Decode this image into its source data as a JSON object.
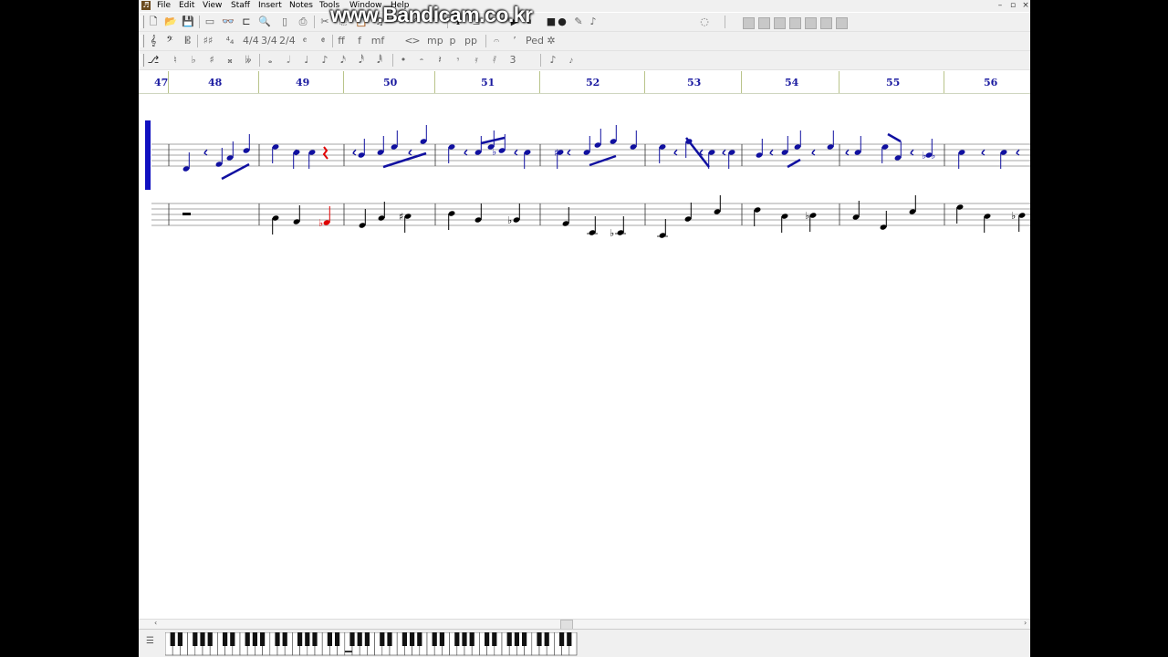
{
  "app": {
    "window_controls": [
      "–",
      "▫",
      "×"
    ]
  },
  "menu": [
    "File",
    "Edit",
    "View",
    "Staff",
    "Insert",
    "Notes",
    "Tools",
    "Window",
    "Help"
  ],
  "watermark": "www.Bandicam.co.kr",
  "toolbar1": {
    "icons": [
      "new-file-icon",
      "open-file-icon",
      "save-icon",
      "print-preview-icon",
      "view-icon",
      "staff-add-icon",
      "zoom-icon",
      "page-icon",
      "print-icon",
      "cut-icon",
      "copy-icon",
      "paste-icon",
      "notes-icon",
      "dash-icon",
      "undo-icon",
      "redo-icon",
      "info-icon",
      "separator-icon",
      "play-icon",
      "pause-icon",
      "stop-icon",
      "record-icon",
      "tool-icon",
      "tool-icon",
      "tool-icon"
    ],
    "glyphs": [
      "🗋",
      "📂",
      "💾",
      "▭",
      "👓",
      "⊏",
      "🔍",
      "▯",
      "⎙",
      "✂",
      "⎘",
      "📋",
      "♫",
      "⇢",
      "↶",
      "↷",
      "ℹ",
      "⊐",
      "▶",
      "⏸",
      "■",
      "●",
      "✎",
      "♪",
      "◌"
    ]
  },
  "toolbar2": {
    "icons": [
      "treble-clef-icon",
      "bass-clef-icon",
      "c-clef-icon",
      "key-sig-icon",
      "time-sig-icon",
      "time-4-4-icon",
      "time-3-4-icon",
      "time-2-4-icon",
      "common-time-icon",
      "cut-time-icon",
      "fortissimo-icon",
      "forte-icon",
      "mezzoforte-icon",
      "crescendo-icon",
      "decrescendo-icon",
      "mezzopiano-icon",
      "piano-icon",
      "pianissimo-icon",
      "fermata-icon",
      "breath-icon",
      "pedal-icon",
      "pedal-up-icon"
    ],
    "glyphs": [
      "𝄞",
      "𝄢",
      "𝄡",
      "♯♯",
      "⁴₄",
      "4/4",
      "3/4",
      "2/4",
      "𝄴",
      "𝄵",
      "ff",
      "f",
      "mf",
      "<",
      ">",
      "mp",
      "p",
      "pp",
      "𝄐",
      "’",
      "Ped",
      "✲"
    ]
  },
  "toolbar3": {
    "icons": [
      "select-tool-icon",
      "natural-icon",
      "flat-icon",
      "sharp-icon",
      "double-sharp-icon",
      "double-flat-icon",
      "whole-note-icon",
      "half-note-icon",
      "quarter-note-icon",
      "eighth-note-icon",
      "sixteenth-note-icon",
      "thirtysecond-note-icon",
      "sixtyfourth-note-icon",
      "dotted-note-icon",
      "half-rest-icon",
      "quarter-rest-icon",
      "eighth-rest-icon",
      "sixteenth-rest-icon",
      "thirtysecond-rest-icon",
      "triplet-icon",
      "grace-note-icon",
      "grace-slash-icon"
    ],
    "glyphs": [
      "⎇",
      "♮",
      "♭",
      "♯",
      "𝄪",
      "𝄫",
      "𝅝",
      "𝅗𝅥",
      "♩",
      "♪",
      "𝅘𝅥𝅯",
      "𝅘𝅥𝅰",
      "𝅘𝅥𝅱",
      "•",
      "𝄼",
      "𝄽",
      "𝄾",
      "𝄿",
      "𝅀",
      "3",
      "♪",
      "𝆔"
    ]
  },
  "ruler": {
    "measures": [
      "47",
      "48",
      "49",
      "50",
      "51",
      "52",
      "53",
      "54",
      "55",
      "56"
    ]
  },
  "colors": {
    "upper_staff_notes": "#1010a0",
    "lower_staff_notes": "#000000",
    "selected_note": "#e00000",
    "ruler_numbers": "#1a1aa0",
    "staff_selection_bar": "#1010c0"
  },
  "scroll": {
    "left_arrow": "‹",
    "right_arrow": "›"
  },
  "keyboard": {
    "grip": "☰"
  }
}
